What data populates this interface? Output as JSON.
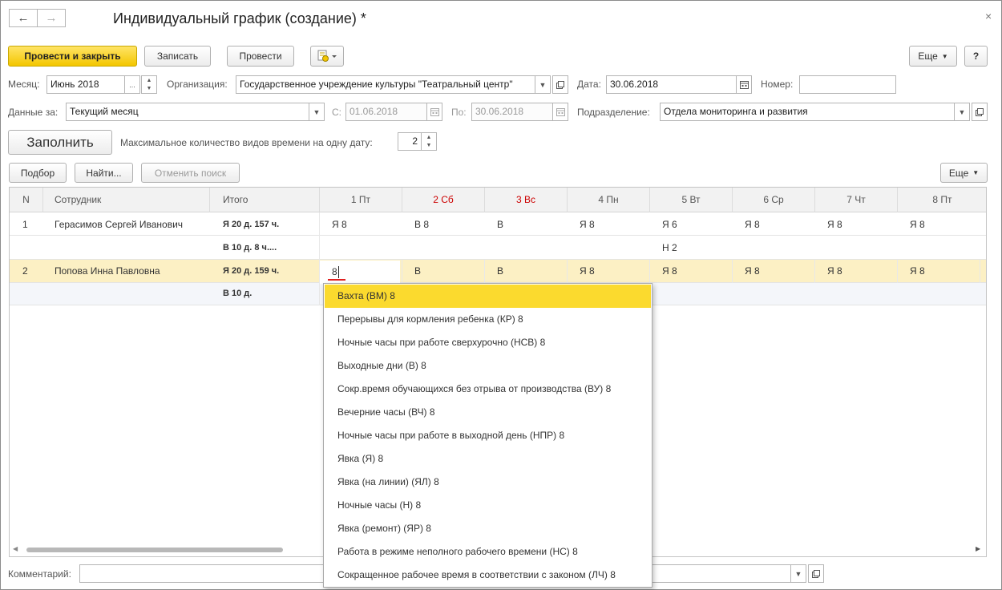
{
  "window": {
    "title": "Индивидуальный график (создание) *",
    "back_icon": "←",
    "forward_icon": "→",
    "close_icon": "×"
  },
  "toolbar": {
    "post_close": "Провести и закрыть",
    "save": "Записать",
    "post": "Провести",
    "more": "Еще",
    "help": "?"
  },
  "header": {
    "month_label": "Месяц:",
    "month_value": "Июнь 2018",
    "month_dots": "...",
    "org_label": "Организация:",
    "org_value": "Государственное учреждение культуры \"Театральный центр\"",
    "date_label": "Дата:",
    "date_value": "30.06.2018",
    "number_label": "Номер:",
    "number_value": "",
    "data_for_label": "Данные за:",
    "data_for_value": "Текущий месяц",
    "from_label": "С:",
    "from_value": "01.06.2018",
    "to_label": "По:",
    "to_value": "30.06.2018",
    "dept_label": "Подразделение:",
    "dept_value": "Отдела мониторинга и развития",
    "fill_button": "Заполнить",
    "max_types_label": "Максимальное количество видов времени на одну дату:",
    "max_types_value": "2"
  },
  "table_toolbar": {
    "pick": "Подбор",
    "find": "Найти...",
    "cancel_search": "Отменить поиск",
    "more": "Еще"
  },
  "table": {
    "columns": [
      "N",
      "Сотрудник",
      "Итого",
      "1 Пт",
      "2 Сб",
      "3 Вс",
      "4 Пн",
      "5 Вт",
      "6 Ср",
      "7 Чт",
      "8 Пт"
    ],
    "weekend_color": "#cc0000",
    "rows": [
      {
        "n": "1",
        "employee": "Герасимов Сергей Иванович",
        "total1": "Я 20 д. 157 ч.",
        "total2": "В 10 д. 8 ч....",
        "days1": [
          "Я 8",
          "В 8",
          "В",
          "Я 8",
          "Я 6",
          "Я 8",
          "Я 8",
          "Я 8"
        ],
        "days2": [
          "",
          "",
          "",
          "",
          "Н 2",
          "",
          "",
          ""
        ]
      },
      {
        "n": "2",
        "employee": "Попова Инна Павловна",
        "total1": "Я 20 д. 159 ч.",
        "total2": "В 10 д.",
        "edit_value": "8",
        "days1": [
          "",
          "В",
          "В",
          "Я 8",
          "Я 8",
          "Я 8",
          "Я 8",
          "Я 8"
        ],
        "days2": [
          "",
          "",
          "",
          "",
          "",
          "",
          "",
          ""
        ]
      }
    ]
  },
  "dropdown": {
    "items": [
      "Вахта (ВМ) 8",
      "Перерывы для кормления ребенка (КР) 8",
      "Ночные часы при работе сверхурочно (НСВ) 8",
      "Выходные дни (В) 8",
      "Сокр.время обучающихся без отрыва от производства (ВУ) 8",
      "Вечерние часы (ВЧ) 8",
      "Ночные часы при работе в выходной день (НПР) 8",
      "Явка (Я) 8",
      "Явка (на линии) (ЯЛ) 8",
      "Ночные часы (Н) 8",
      "Явка (ремонт) (ЯР) 8",
      "Работа в режиме неполного рабочего времени (НС) 8",
      "Сокращенное рабочее время в соответствии с законом (ЛЧ) 8"
    ]
  },
  "footer": {
    "comment_label": "Комментарий:",
    "comment_value": ""
  },
  "colors": {
    "primary_button": "#f3c600",
    "selected_row": "#fcf0c4",
    "dropdown_active": "#fbda2e",
    "error_underline": "#e02020"
  }
}
